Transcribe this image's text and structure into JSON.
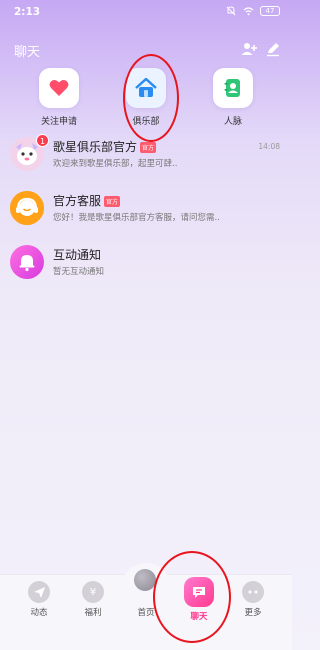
{
  "status_bar": {
    "time": "2:13",
    "battery": "47"
  },
  "header": {
    "title": "聊天",
    "add_friend_icon": "add-person-icon",
    "edit_icon": "pencil-icon"
  },
  "quick_actions": [
    {
      "label": "关注申请",
      "icon": "heart-icon",
      "color": "#ff4d6a"
    },
    {
      "label": "俱乐部",
      "icon": "house-icon",
      "color": "#2a8cf0"
    },
    {
      "label": "人脉",
      "icon": "contacts-book-icon",
      "color": "#2fc777"
    }
  ],
  "chats": [
    {
      "name": "歌星俱乐部官方",
      "tag": "官方",
      "preview": "欢迎来到歌星俱乐部，起里可肆..",
      "time": "14:08",
      "unread": "1",
      "avatar_icon": "cartoon-mascot-avatar"
    },
    {
      "name": "官方客服",
      "tag": "官方",
      "preview": "您好！我是歌星俱乐部官方客服，请问您需..",
      "time": "",
      "unread": "",
      "avatar_icon": "headset-avatar"
    },
    {
      "name": "互动通知",
      "tag": "",
      "preview": "暂无互动通知",
      "time": "",
      "unread": "",
      "avatar_icon": "bell-avatar"
    }
  ],
  "tab_bar": {
    "items": [
      {
        "label": "动态",
        "icon": "paper-plane-icon"
      },
      {
        "label": "福利",
        "icon": "yen-icon"
      },
      {
        "label": "首页",
        "icon": "home-ball-icon"
      },
      {
        "label": "聊天",
        "icon": "chat-bubble-icon",
        "active": true
      },
      {
        "label": "更多",
        "icon": "more-dots-icon"
      }
    ]
  },
  "colors": {
    "accent": "#ff3a8f",
    "annotation": "#e8141e"
  }
}
